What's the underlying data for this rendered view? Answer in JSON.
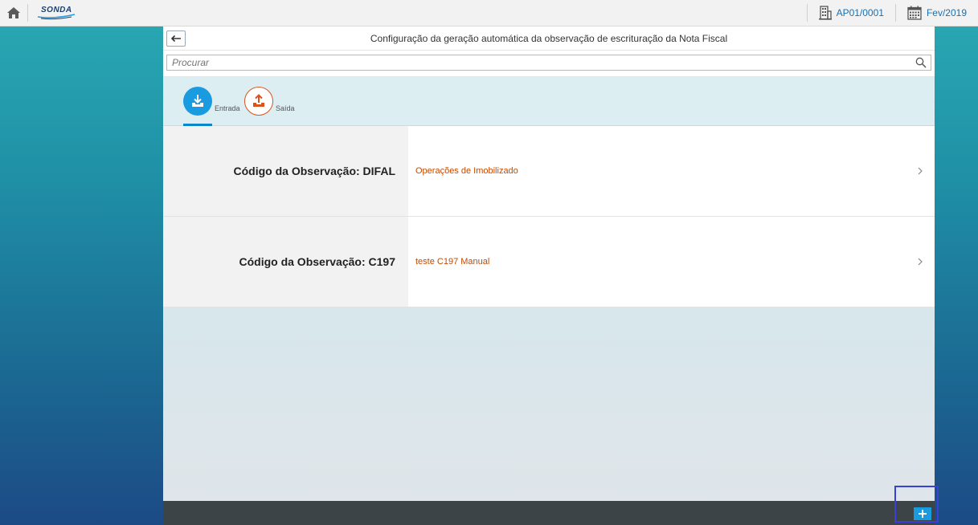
{
  "shell": {
    "logo_text": "SONDA",
    "org_unit": "AP01/0001",
    "period": "Fev/2019"
  },
  "header": {
    "title": "Configuração da geração automática da observação de escrituração da Nota Fiscal"
  },
  "search": {
    "placeholder": "Procurar"
  },
  "tabs": [
    {
      "label": "Entrada",
      "icon": "download-inbox-icon",
      "color": "#1a9be0",
      "active": true
    },
    {
      "label": "Saída",
      "icon": "upload-outbox-icon",
      "color": "#d9531e",
      "active": false
    }
  ],
  "list": {
    "items": [
      {
        "code_label": "Código da Observação: DIFAL",
        "description": "Operações de Imobilizado"
      },
      {
        "code_label": "Código da Observação: C197",
        "description": "teste C197 Manual"
      }
    ]
  },
  "colors": {
    "accent": "#1a9be0",
    "link_orange": "#c44a00",
    "shell_link": "#1a6fb0",
    "footer": "#3c4447"
  }
}
